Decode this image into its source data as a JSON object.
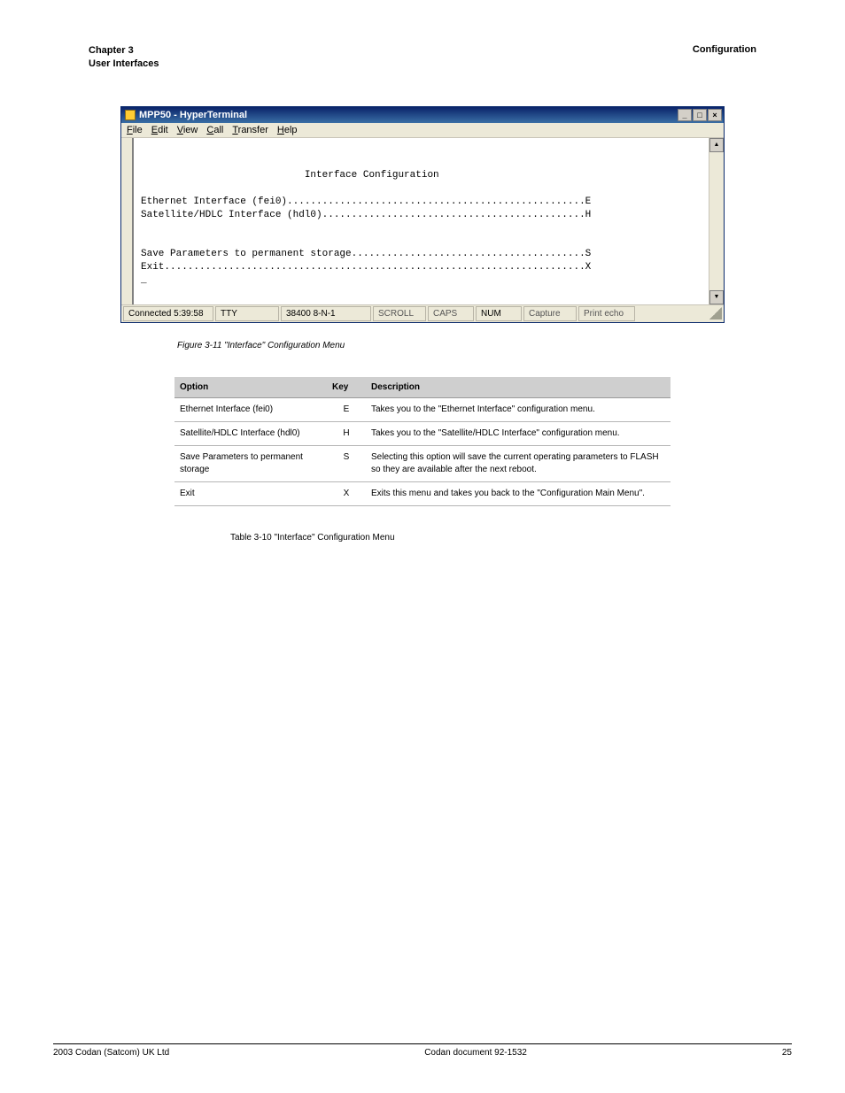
{
  "header": {
    "title_line1": "Chapter 3",
    "title_line2": "User Interfaces",
    "section": "Configuration"
  },
  "hyperterminal": {
    "title": "MPP50 - HyperTerminal",
    "menus": {
      "file": "File",
      "edit": "Edit",
      "view": "View",
      "call": "Call",
      "transfer": "Transfer",
      "help": "Help"
    },
    "terminal": {
      "heading": "Interface Configuration",
      "lines": [
        "Ethernet Interface (fei0)...................................................E",
        "Satellite/HDLC Interface (hdl0).............................................H",
        "",
        "",
        "Save Parameters to permanent storage........................................S",
        "Exit........................................................................X",
        "_"
      ]
    },
    "status": {
      "connected": "Connected 5:39:58",
      "device": "TTY",
      "settings": "38400 8-N-1",
      "scroll": "SCROLL",
      "caps": "CAPS",
      "num": "NUM",
      "capture": "Capture",
      "printecho": "Print echo"
    }
  },
  "figure_caption": "Figure 3-11  \"Interface\" Configuration Menu",
  "table": {
    "headers": {
      "option": "Option",
      "key": "Key",
      "description": "Description"
    },
    "rows": [
      {
        "option": "Ethernet Interface (fei0)",
        "key": "E",
        "description": "Takes you to the \"Ethernet Interface\" configuration menu."
      },
      {
        "option": "Satellite/HDLC Interface (hdl0)",
        "key": "H",
        "description": "Takes you to the \"Satellite/HDLC Interface\" configuration menu."
      },
      {
        "option": "Save Parameters to permanent storage",
        "key": "S",
        "description": "Selecting this option will save the current operating parameters to FLASH so they are available after the next reboot."
      },
      {
        "option": "Exit",
        "key": "X",
        "description": "Exits this menu and takes you back to the \"Configuration Main Menu\"."
      }
    ],
    "caption": "Table 3-10  \"Interface\" Configuration Menu"
  },
  "footer": {
    "left": "2003 Codan (Satcom) UK Ltd",
    "center": "Codan document 92-1532",
    "right": "25"
  }
}
